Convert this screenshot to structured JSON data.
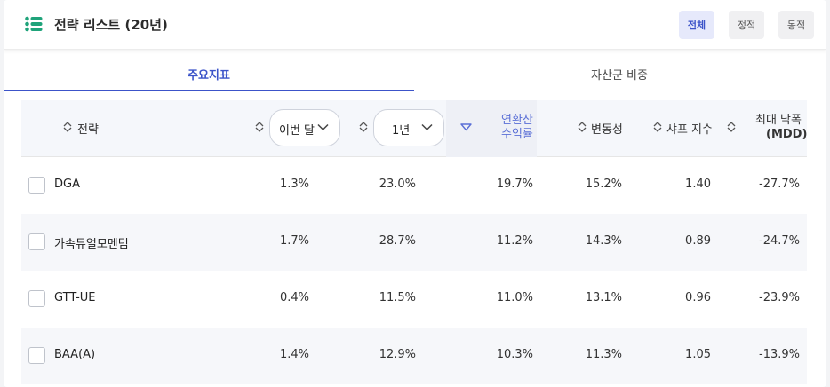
{
  "header": {
    "title": "전략 리스트 (20년)",
    "filters": [
      {
        "label": "전체",
        "active": true
      },
      {
        "label": "정적",
        "active": false
      },
      {
        "label": "동적",
        "active": false
      }
    ]
  },
  "tabs": [
    {
      "label": "주요지표",
      "active": true
    },
    {
      "label": "자산군 비중",
      "active": false
    }
  ],
  "table": {
    "col_strategy": "전략",
    "period_select": "이번 달",
    "range_select": "1년",
    "annual_line1": "연환산",
    "annual_line2": "수익률",
    "volatility": "변동성",
    "sharpe": "샤프 지수",
    "mdd_line1": "최대 낙폭",
    "mdd_line2": "(MDD)",
    "rows": [
      {
        "name": "DGA",
        "month": "1.3%",
        "year": "23.0%",
        "annual": "19.7%",
        "vol": "15.2%",
        "sharpe": "1.40",
        "mdd": "-27.7%"
      },
      {
        "name": "가속듀얼모멘텀",
        "month": "1.7%",
        "year": "28.7%",
        "annual": "11.2%",
        "vol": "14.3%",
        "sharpe": "0.89",
        "mdd": "-24.7%"
      },
      {
        "name": "GTT-UE",
        "month": "0.4%",
        "year": "11.5%",
        "annual": "11.0%",
        "vol": "13.1%",
        "sharpe": "0.96",
        "mdd": "-23.9%"
      },
      {
        "name": "BAA(A)",
        "month": "1.4%",
        "year": "12.9%",
        "annual": "10.3%",
        "vol": "11.3%",
        "sharpe": "1.05",
        "mdd": "-13.9%"
      }
    ]
  },
  "colors": {
    "accent": "#3c54c9",
    "list_icon": "#1fa37a"
  }
}
